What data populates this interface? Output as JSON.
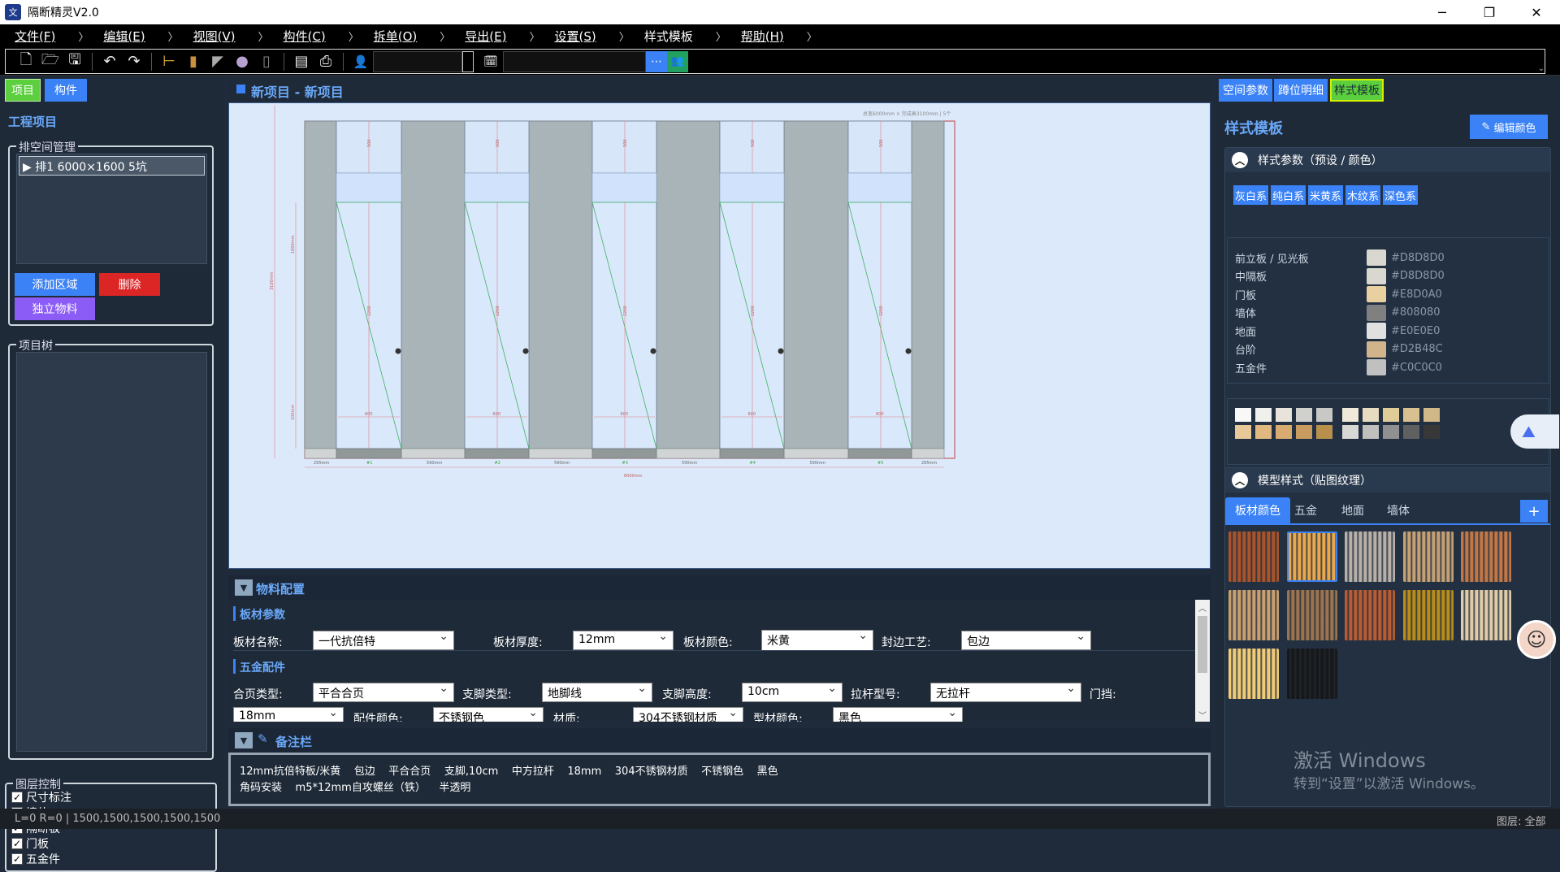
{
  "window": {
    "title": "隔断精灵V2.0",
    "logo": "文"
  },
  "menu": [
    {
      "label": "文件(F)",
      "u": true
    },
    {
      "label": "编辑(E)",
      "u": true
    },
    {
      "label": "视图(V)",
      "u": true
    },
    {
      "label": "构件(C)",
      "u": true
    },
    {
      "label": "拆单(O)",
      "u": true
    },
    {
      "label": "导出(E)",
      "u": true
    },
    {
      "label": "设置(S)",
      "u": true
    },
    {
      "label": "样式模板",
      "u": false
    },
    {
      "label": "帮助(H)",
      "u": true
    }
  ],
  "left": {
    "tab_project": "项目",
    "tab_component": "构件",
    "section_title": "工程项目",
    "row_mgmt_legend": "排空间管理",
    "row_item": "▶ 排1  6000×1600 5坑",
    "btn_add_area": "添加区域",
    "btn_delete": "删除",
    "btn_material": "独立物料",
    "tree_legend": "项目树",
    "layer_legend": "图层控制",
    "layers": [
      "尺寸标注",
      "墙体",
      "隔断板",
      "门板",
      "五金件"
    ]
  },
  "canvas": {
    "title": "新项目 - 新项目",
    "info": "总宽6000mm × 完成高3100mm | 5个",
    "dims": {
      "left_outer": "295mm",
      "gap": "590mm",
      "door": "600",
      "total": "6000mm",
      "upper": "500",
      "door_h": "2200",
      "bottom": "100mm",
      "h_total": "3100mm",
      "h_partition": "1800mm",
      "stall_labels": [
        "#1",
        "#2",
        "#3",
        "#4",
        "#5"
      ]
    }
  },
  "material": {
    "header": "物料配置",
    "board_section": "板材参数",
    "board_name_label": "板材名称:",
    "board_name": "一代抗倍特",
    "board_thick_label": "板材厚度:",
    "board_thick": "12mm",
    "board_color_label": "板材颜色:",
    "board_color": "米黄",
    "edge_label": "封边工艺:",
    "edge": "包边",
    "hw_section": "五金配件",
    "hinge_label": "合页类型:",
    "hinge": "平合合页",
    "foot_label": "支脚类型:",
    "foot": "地脚线",
    "foot_h_label": "支脚高度:",
    "foot_h": "10cm",
    "pull_label": "拉杆型号:",
    "pull": "无拉杆",
    "stop_label": "门挡:",
    "row3": [
      "18mm",
      "配件颜色:",
      "不锈钢色",
      "材质:",
      "304不锈钢材质",
      "型材颜色:",
      "黑色"
    ]
  },
  "notes": {
    "header": "备注栏",
    "line1": "12mm抗倍特板/米黄    包边    平合合页    支脚,10cm    中方拉杆    18mm    304不锈钢材质    不锈钢色    黑色",
    "line2": "角码安装    m5*12mm自攻螺丝（铁）    半透明"
  },
  "status": {
    "left": "L=0 R=0 | 1500,1500,1500,1500,1500",
    "right": "图层: 全部"
  },
  "right": {
    "tab_space": "空间参数",
    "tab_stall": "蹲位明细",
    "tab_template": "样式模板",
    "title": "样式模板",
    "edit_color_btn": "编辑颜色",
    "params_title": "样式参数（预设 / 颜色）",
    "presets": [
      "灰白系",
      "纯白系",
      "米黄系",
      "木纹系",
      "深色系"
    ],
    "colors": [
      {
        "name": "前立板 / 见光板",
        "hex": "#D8D8D0"
      },
      {
        "name": "中隔板",
        "hex": "#D8D8D0"
      },
      {
        "name": "门板",
        "hex": "#E8D0A0"
      },
      {
        "name": "墙体",
        "hex": "#808080"
      },
      {
        "name": "地面",
        "hex": "#E0E0E0"
      },
      {
        "name": "台阶",
        "hex": "#D2B48C"
      },
      {
        "name": "五金件",
        "hex": "#C0C0C0"
      }
    ],
    "palette": [
      "#f8f8f8",
      "#f0f0ec",
      "#e8e4dc",
      "#d0d0cc",
      "#c8c8c4",
      "#f0e8d8",
      "#e8dcc0",
      "#e0cc98",
      "#d8c090",
      "#d0b888",
      "#e8c898",
      "#e0b880",
      "#d8ac70",
      "#c89c60",
      "#b8904c",
      "#d8d8d4",
      "#c0c0bc",
      "#909090",
      "#606060",
      "#383838"
    ],
    "model_title": "模型样式（贴图纹理）",
    "model_tabs": [
      "板材颜色",
      "五金",
      "地面",
      "墙体"
    ],
    "textures": [
      "#a8542c",
      "#e8a850",
      "#b8b0a8",
      "#c4a074",
      "#c07848",
      "#c8a070",
      "#9c7450",
      "#b85c34",
      "#b88c1c",
      "#e0cca8",
      "#f0cc78",
      "#181818"
    ]
  },
  "watermark": {
    "line1": "激活 Windows",
    "line2": "转到“设置”以激活 Windows。"
  }
}
